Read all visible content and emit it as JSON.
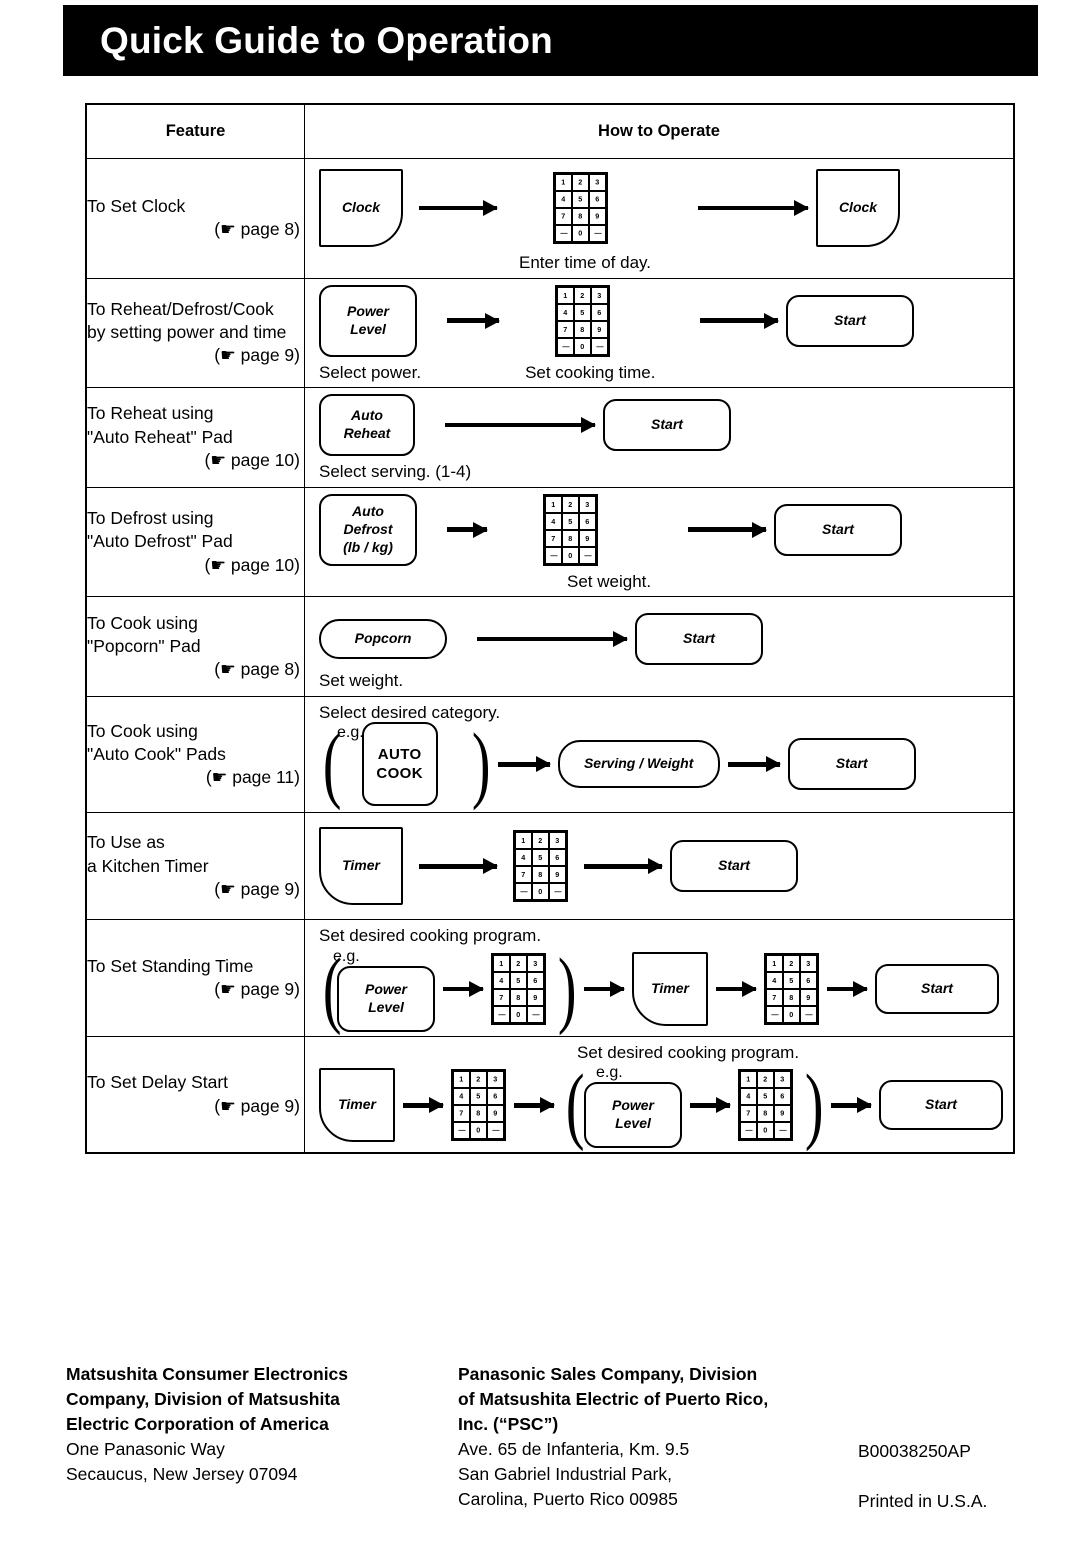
{
  "header": {
    "title": "Quick Guide to Operation"
  },
  "table": {
    "columns": {
      "feature": "Feature",
      "how_to_operate": "How to Operate"
    },
    "rows": [
      {
        "feature_lines": [
          "To Set Clock"
        ],
        "page_ref": "(☛ page 8)",
        "caption_bottom": "Enter time of day.",
        "pads": {
          "first": "Clock",
          "last": "Clock"
        }
      },
      {
        "feature_lines": [
          "To Reheat/Defrost/Cook",
          "by setting power and time"
        ],
        "page_ref": "(☛ page 9)",
        "caption_left": "Select power.",
        "caption_mid": "Set cooking time.",
        "pads": {
          "first_l1": "Power",
          "first_l2": "Level",
          "last": "Start"
        }
      },
      {
        "feature_lines": [
          "To Reheat using",
          "\"Auto Reheat\" Pad"
        ],
        "page_ref": "(☛ page 10)",
        "caption_left": "Select serving. (1-4)",
        "pads": {
          "first_l1": "Auto",
          "first_l2": "Reheat",
          "last": "Start"
        }
      },
      {
        "feature_lines": [
          "To Defrost using",
          "\"Auto Defrost\" Pad"
        ],
        "page_ref": "(☛ page 10)",
        "caption_mid": "Set weight.",
        "pads": {
          "first_l1": "Auto",
          "first_l2": "Defrost",
          "first_l3": "(lb / kg)",
          "last": "Start"
        }
      },
      {
        "feature_lines": [
          "To Cook using",
          "\"Popcorn\" Pad"
        ],
        "page_ref": "(☛ page 8)",
        "caption_left": "Set weight.",
        "pads": {
          "first": "Popcorn",
          "last": "Start"
        }
      },
      {
        "feature_lines": [
          "To Cook using",
          "\"Auto Cook\" Pads"
        ],
        "page_ref": "(☛ page 11)",
        "caption_top": "Select desired category.",
        "eg": "e.g.",
        "pads": {
          "first_l1": "AUTO",
          "first_l2": "COOK",
          "mid": "Serving / Weight",
          "last": "Start"
        }
      },
      {
        "feature_lines": [
          "To Use as",
          "a Kitchen Timer"
        ],
        "page_ref": "(☛ page 9)",
        "pads": {
          "first": "Timer",
          "last": "Start"
        }
      },
      {
        "feature_lines": [
          "To Set Standing Time"
        ],
        "page_ref": "(☛ page 9)",
        "caption_top": "Set desired cooking program.",
        "eg": "e.g.",
        "pads": {
          "first_l1": "Power",
          "first_l2": "Level",
          "mid": "Timer",
          "last": "Start"
        }
      },
      {
        "feature_lines": [
          "To Set Delay Start"
        ],
        "page_ref": "(☛ page 9)",
        "caption_top": "Set desired cooking program.",
        "eg": "e.g.",
        "pads": {
          "first": "Timer",
          "mid_l1": "Power",
          "mid_l2": "Level",
          "last": "Start"
        }
      }
    ]
  },
  "keypad": {
    "keys": [
      "1",
      "2",
      "3",
      "4",
      "5",
      "6",
      "7",
      "8",
      "9",
      "—",
      "0",
      "—"
    ]
  },
  "footer": {
    "col1": {
      "bold_lines": [
        "Matsushita Consumer Electronics",
        "Company, Division of Matsushita",
        "Electric Corporation of America"
      ],
      "plain_lines": [
        "One Panasonic Way",
        "Secaucus, New Jersey 07094"
      ]
    },
    "col2": {
      "bold_lines": [
        "Panasonic Sales Company, Division",
        "of Matsushita Electric of Puerto Rico,",
        "Inc. (“PSC”)"
      ],
      "plain_lines": [
        "Ave. 65 de Infanteria, Km. 9.5",
        "San Gabriel Industrial Park,",
        "Carolina, Puerto Rico 00985"
      ]
    },
    "col3": {
      "part_number": "B00038250AP",
      "printed_in": "Printed in U.S.A."
    }
  }
}
